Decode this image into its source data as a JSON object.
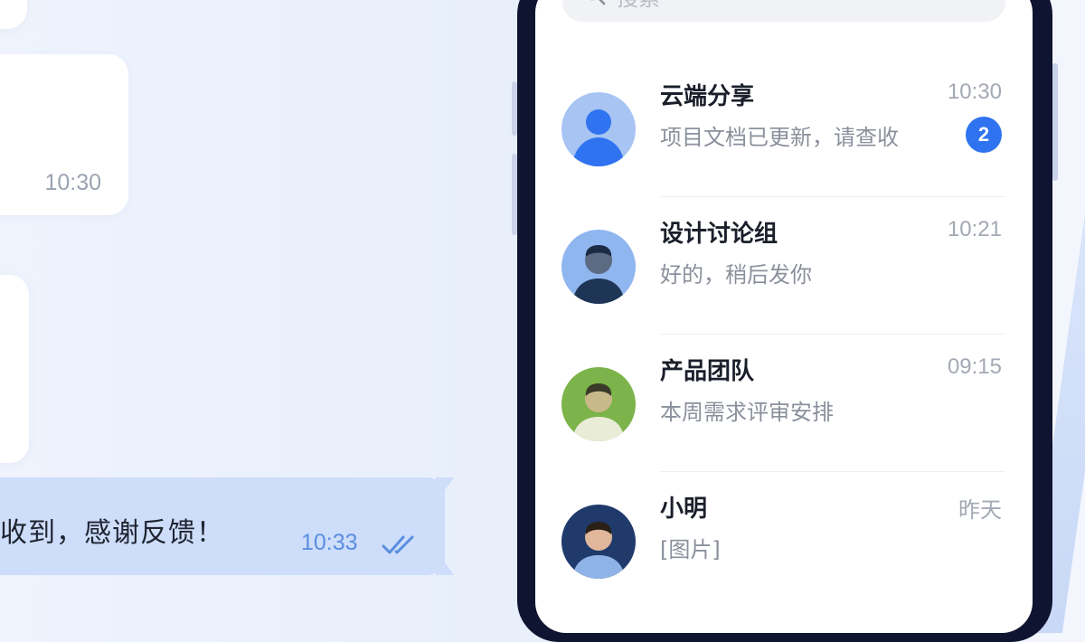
{
  "chat": {
    "incoming_time": "10:30",
    "outgoing_message": "收到，感谢反馈！",
    "outgoing_time": "10:33"
  },
  "search": {
    "placeholder": "搜索"
  },
  "conversations": [
    {
      "name": "云端分享",
      "preview": "项目文档已更新，请查收",
      "time": "10:30",
      "unread": "2",
      "avatar_color": "#2f73f0"
    },
    {
      "name": "设计讨论组",
      "preview": "好的，稍后发你",
      "time": "10:21",
      "unread": "",
      "avatar_color": "#6a9be8"
    },
    {
      "name": "产品团队",
      "preview": "本周需求评审安排",
      "time": "09:15",
      "unread": "",
      "avatar_color": "#7cb34a"
    },
    {
      "name": "小明",
      "preview": "[图片]",
      "time": "昨天",
      "unread": "",
      "avatar_color": "#1f3a6b"
    }
  ],
  "colors": {
    "accent": "#2f73f0",
    "bubble_outgoing": "#cdddfa",
    "phone_frame": "#0f1430"
  }
}
